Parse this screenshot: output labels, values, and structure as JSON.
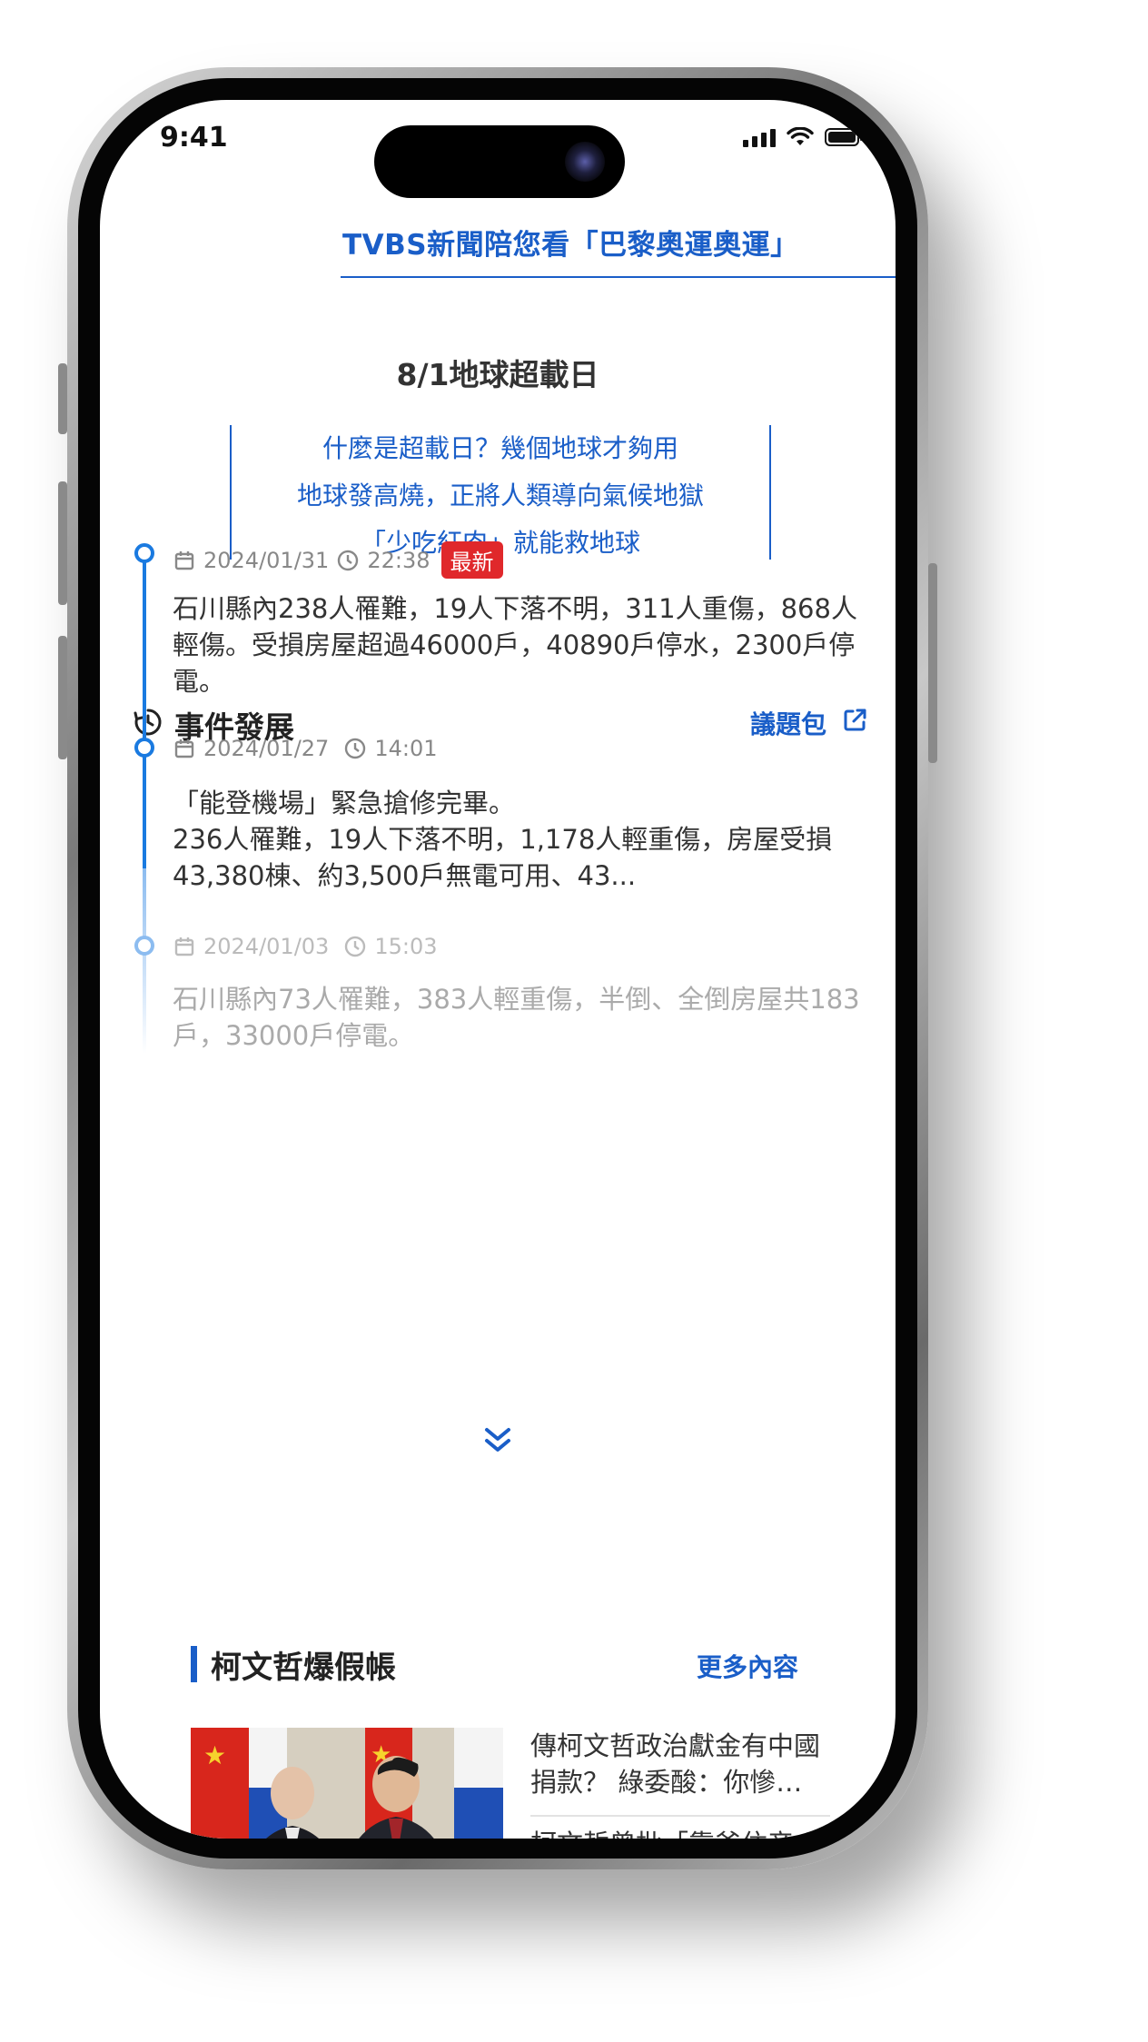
{
  "status_bar": {
    "time": "9:41"
  },
  "promo_link": "TVBS新聞陪您看「巴黎奧運奧運」",
  "overload": {
    "title": "8/1地球超載日",
    "links": [
      "什麼是超載日？幾個地球才夠用",
      "地球發高燒，正將人類導向氣候地獄",
      "「少吃紅肉」就能救地球"
    ]
  },
  "timeline": {
    "title": "事件發展",
    "issue_pack_label": "議題包",
    "events": [
      {
        "date": "2024/01/31",
        "time": "22:38",
        "badge": "最新",
        "text": "石川縣內238人罹難，19人下落不明，311人重傷，868人輕傷。受損房屋超過46000戶，40890戶停水，2300戶停電。"
      },
      {
        "date": "2024/01/27",
        "time": "14:01",
        "text_line1": "「能登機場」緊急搶修完畢。",
        "text_line2": "236人罹難，19人下落不明，1,178人輕重傷，房屋受損43,380棟、約3,500戶無電可用、43..."
      },
      {
        "date": "2024/01/03",
        "time": "15:03",
        "text": "石川縣內73人罹難，383人輕重傷，半倒、全倒房屋共183戶，33000戶停電。"
      }
    ]
  },
  "section": {
    "title": "柯文哲爆假帳",
    "more_label": "更多內容",
    "news": [
      {
        "title": "傳柯文哲政治獻金有中國捐款？ 綠委酸：你慘…"
      },
      {
        "title": "柯文哲曾批「靠爸住帝"
      }
    ]
  },
  "colors": {
    "accent": "#1a5ec8",
    "badge": "#e0282b",
    "timeline": "#1a7ae0"
  }
}
